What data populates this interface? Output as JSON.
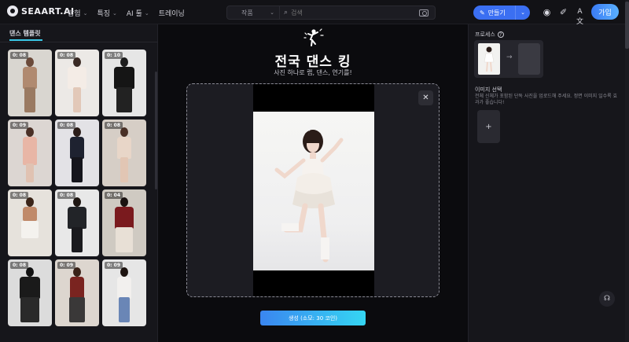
{
  "brand": {
    "name": "SEAART.AI"
  },
  "nav": {
    "items": [
      {
        "label": "탐험"
      },
      {
        "label": "특징"
      },
      {
        "label": "AI 툴"
      },
      {
        "label": "트레이닝"
      }
    ]
  },
  "search": {
    "category": "작품",
    "placeholder": "검색"
  },
  "header": {
    "create_label": "만들기",
    "join_label": "가입"
  },
  "sidebar": {
    "title": "댄스 템플릿",
    "templates": [
      {
        "badge": "0: 08"
      },
      {
        "badge": "0: 08"
      },
      {
        "badge": "0: 10"
      },
      {
        "badge": "0: 09"
      },
      {
        "badge": "0: 08"
      },
      {
        "badge": "0: 08"
      },
      {
        "badge": "0: 08"
      },
      {
        "badge": "0: 08"
      },
      {
        "badge": "0: 04"
      },
      {
        "badge": "0: 08"
      },
      {
        "badge": "0: 09"
      },
      {
        "badge": "0: 09"
      }
    ]
  },
  "main": {
    "title": "전국 댄스 킹",
    "subtitle": "사진 하나로 랩, 댄스, 연기를!",
    "generate_label": "생성 (소모: 30 코인)"
  },
  "right": {
    "process_label": "프로세스",
    "image_select_label": "이미지 선택",
    "image_select_desc": "전체 신체가 포함된 단독 사진을 업로드해 주세요. 정면 이미지 일수록 효과가 좋습니다!"
  },
  "colors": {
    "accent": "#3b6ff2",
    "cyan": "#35d6f2",
    "bg": "#0d0d10"
  }
}
